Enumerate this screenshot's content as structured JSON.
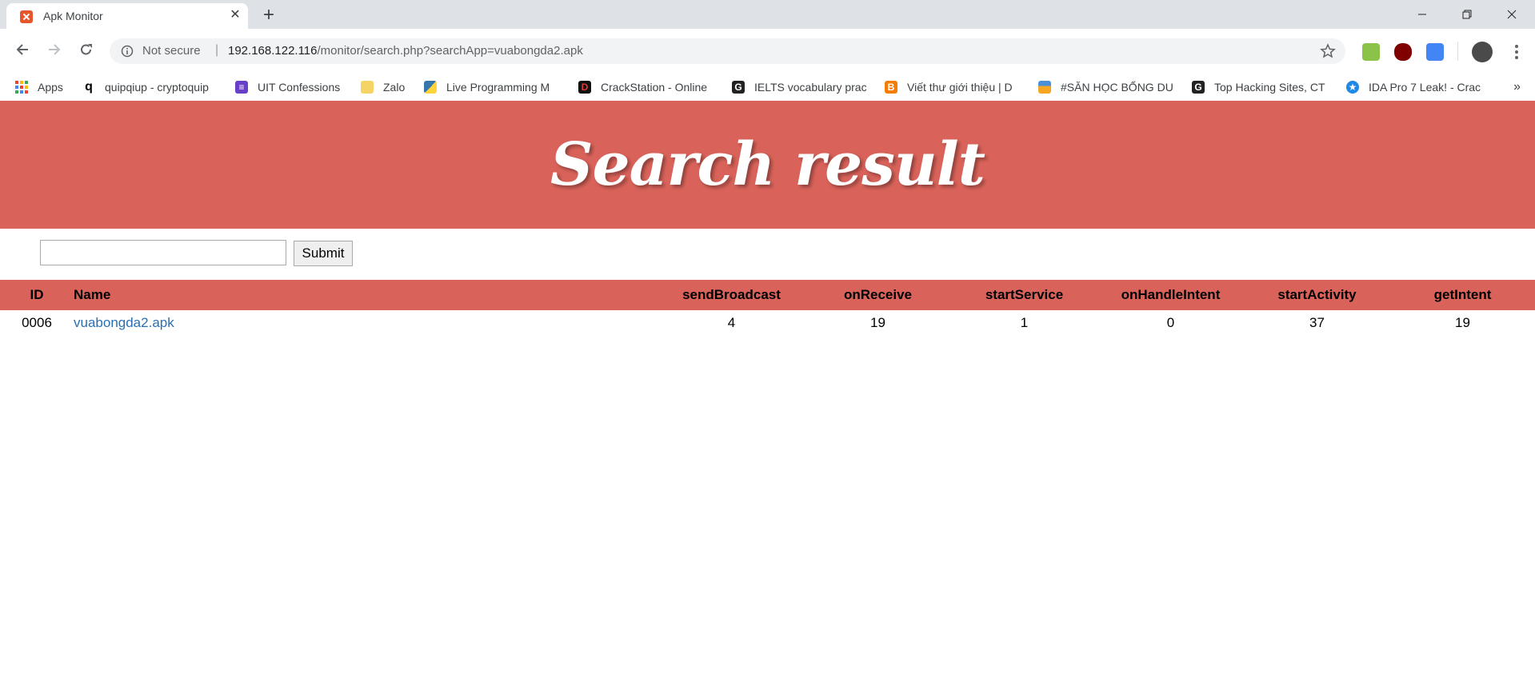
{
  "browser": {
    "tab_title": "Apk Monitor",
    "tab_close": "✕",
    "new_tab": "+",
    "address": {
      "security_label": "Not secure",
      "separator": "|",
      "url_host": "192.168.122.116",
      "url_path": "/monitor/search.php?searchApp=vuabongda2.apk"
    },
    "bookmarks": [
      {
        "label": "Apps",
        "icon": "apps-grid-icon"
      },
      {
        "label": "quipqiup - cryptoquip",
        "icon": "q-icon"
      },
      {
        "label": "UIT Confessions",
        "icon": "list-icon"
      },
      {
        "label": "Zalo",
        "icon": "folder-icon"
      },
      {
        "label": "Live Programming M",
        "icon": "python-icon"
      },
      {
        "label": "CrackStation - Online",
        "icon": "crackstation-icon"
      },
      {
        "label": "IELTS vocabulary prac",
        "icon": "g-icon"
      },
      {
        "label": "Viết thư giới thiệu | D",
        "icon": "blogger-icon"
      },
      {
        "label": "#SĂN HỌC BỔNG DU",
        "icon": "folder-stack-icon"
      },
      {
        "label": "Top Hacking Sites, CT",
        "icon": "g-icon"
      },
      {
        "label": "IDA Pro 7 Leak! - Crac",
        "icon": "star-badge-icon"
      }
    ],
    "bookmarks_more": "»"
  },
  "page": {
    "banner_title": "Search result",
    "search": {
      "value": "",
      "submit_label": "Submit"
    },
    "table": {
      "headers": [
        "ID",
        "Name",
        "sendBroadcast",
        "onReceive",
        "startService",
        "onHandleIntent",
        "startActivity",
        "getIntent"
      ],
      "rows": [
        {
          "id": "0006",
          "name": "vuabongda2.apk",
          "sendBroadcast": "4",
          "onReceive": "19",
          "startService": "1",
          "onHandleIntent": "0",
          "startActivity": "37",
          "getIntent": "19"
        }
      ]
    }
  },
  "colors": {
    "banner": "#d9635a",
    "link": "#2a6fb5"
  }
}
